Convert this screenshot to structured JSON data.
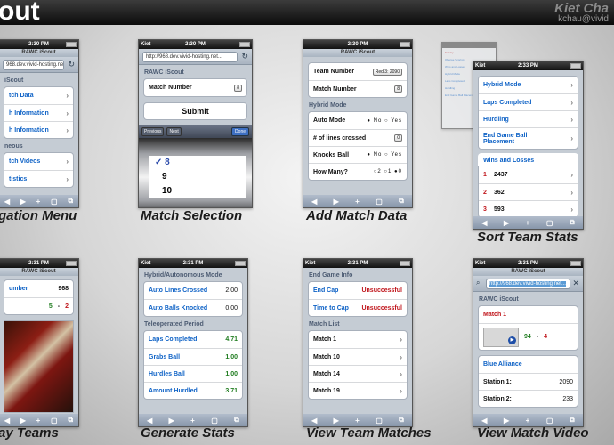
{
  "header": {
    "title": "out",
    "author": "Kiet Cha",
    "email": "kchau@vivid"
  },
  "captions": [
    "gation Menu",
    "Match Selection",
    "Add Match Data",
    "Sort Team Stats",
    "ay Teams",
    "Generate Stats",
    "View Team Matches",
    "View Match Video"
  ],
  "time1": "2:30 PM",
  "time2": "2:31 PM",
  "time3": "2:33 PM",
  "carrier": "Kiet",
  "app_title": "RAWC iScout",
  "toolbar": {
    "back": "◀",
    "fwd": "▶",
    "add": "+",
    "book": "▢",
    "tabs": "⧉"
  },
  "nav": {
    "url": "968.dev.vivid-hosting.net/",
    "section1": "iScout",
    "items1": [
      "tch Data",
      "h Information",
      "h Information"
    ],
    "section2": "neous",
    "items2": [
      "tch Videos",
      "tistics"
    ]
  },
  "match_sel": {
    "url": "http://968.dev.vivid-hosting.net...",
    "header": "RAWC iScout",
    "label": "Match Number",
    "value": "8",
    "submit": "Submit",
    "prev": "Previous",
    "next": "Next",
    "done": "Done",
    "picker": [
      "✓ 8",
      "9",
      "10"
    ]
  },
  "add_match": {
    "team_label": "Team Number",
    "team_value": "Red 3: 2090",
    "match_label": "Match Number",
    "match_value": "8",
    "section": "Hybrid Mode",
    "auto": "Auto Mode",
    "no": "No",
    "yes": "Yes",
    "lines": "# of lines crossed",
    "lines_value": "0",
    "knocks": "Knocks Ball",
    "howmany": "How Many?",
    "hm_opts": "○2 ○1 ●0"
  },
  "sort": {
    "items": [
      "Hybrid Mode",
      "Laps Completed",
      "Hurdling",
      "End Game Ball Placement"
    ],
    "section": "Wins and Losses",
    "rows": [
      {
        "rank": "1",
        "team": "2437"
      },
      {
        "rank": "2",
        "team": "362"
      },
      {
        "rank": "3",
        "team": "593"
      }
    ],
    "back_list": [
      "Sort by",
      "Offense Scoring",
      "Wins and Losses",
      "Hybrid Mode",
      "Laps Completed",
      "Hurdling",
      "End Game Ball Placement"
    ]
  },
  "teams": {
    "label": "umber",
    "value": "968",
    "score_a": "5",
    "dash": "-",
    "score_b": "2"
  },
  "gen": {
    "section1": "Hybrid/Autonomous Mode",
    "rows1": [
      {
        "label": "Auto Lines Crossed",
        "value": "2.00"
      },
      {
        "label": "Auto Balls Knocked",
        "value": "0.00"
      }
    ],
    "section2": "Teleoperated Period",
    "rows2": [
      {
        "label": "Laps Completed",
        "value": "4.71"
      },
      {
        "label": "Grabs Ball",
        "value": "1.00"
      },
      {
        "label": "Hurdles Ball",
        "value": "1.00"
      },
      {
        "label": "Amount Hurdled",
        "value": "3.71"
      }
    ]
  },
  "vtm": {
    "section1": "End Game Info",
    "rows1": [
      {
        "label": "End Cap",
        "value": "Unsuccessful"
      },
      {
        "label": "Time to Cap",
        "value": "Unsuccessful"
      }
    ],
    "section2": "Match List",
    "matches": [
      "Match 1",
      "Match 10",
      "Match 14",
      "Match 19"
    ]
  },
  "vid": {
    "url": "http://968.dev.vivid-hosting.net...",
    "header": "RAWC iScout",
    "match": "Match 1",
    "score_a": "94",
    "dash": "-",
    "score_b": "4",
    "alliance": "Blue Alliance",
    "stations": [
      {
        "label": "Station 1:",
        "value": "2090"
      },
      {
        "label": "Station 2:",
        "value": "233"
      }
    ]
  }
}
